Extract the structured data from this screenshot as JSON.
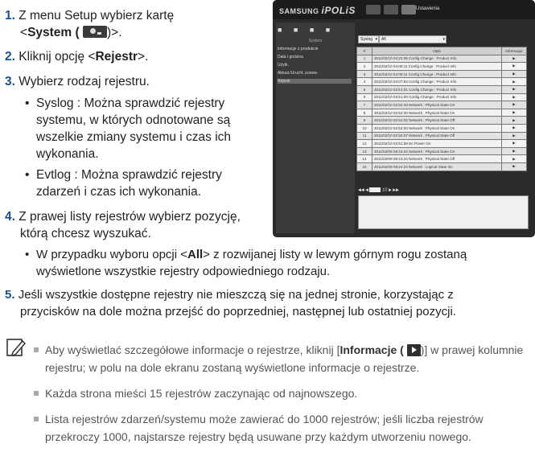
{
  "steps": {
    "s1": {
      "num": "1.",
      "a": "Z menu Setup wybierz kartę",
      "b": "<",
      "bold": "System (",
      "c": ")>."
    },
    "s2": {
      "num": "2.",
      "a": "Kliknij opcję <",
      "bold": "Rejestr",
      "c": ">."
    },
    "s3": {
      "num": "3.",
      "a": "Wybierz rodzaj rejestru."
    },
    "b1": [
      "Syslog : Można sprawdzić rejestry",
      "systemu, w których odnotowane są",
      "wszelkie zmiany systemu i czas ich",
      "wykonania."
    ],
    "b2": [
      "Evtlog : Można sprawdzić rejestry",
      "zdarzeń i czas ich wykonania."
    ],
    "s4": {
      "num": "4.",
      "line1": "Z prawej listy rejestrów wybierz pozycję,",
      "line2": "którą chcesz wyszukać."
    },
    "b3": {
      "a": "W przypadku wyboru opcji <",
      "bold": "All",
      "c": "> z rozwijanej listy w lewym górnym rogu zostaną",
      "line2": "wyświetlone wszystkie rejestry odpowiedniego rodzaju."
    },
    "s5": {
      "num": "5.",
      "line1": "Jeśli wszystkie dostępne rejestry nie mieszczą się na jednej stronie, korzystając z",
      "line2": "przycisków na dole można przejść do poprzedniej, następnej lub ostatniej pozycji."
    }
  },
  "notes": {
    "n1": {
      "a": "Aby wyświetlać szczegółowe informacje o rejestrze, kliknij [",
      "bold": "Informacje (",
      "c": ")] w prawej kolumnie",
      "line2": "rejestru; w polu na dole ekranu zostaną wyświetlone informacje o rejestrze."
    },
    "n2": "Każda strona mieści 15 rejestrów zaczynając od najnowszego.",
    "n3": [
      "Lista rejestrów zdarzeń/systemu może zawierać do 1000 rejestrów; jeśli liczba rejestrów",
      "przekroczy 1000, najstarsze rejestry będą usuwane przy każdym utworzeniu nowego."
    ]
  },
  "screenshot": {
    "logo_a": "SAMSUNG ",
    "logo_b": "iPOLiS",
    "title": "Ustawienia",
    "side_header": "System",
    "side_items": [
      "Informacje o produkcie",
      "Data i godzina",
      "Użytk.",
      "Aktual./Urucht. ponow.",
      "Rejestr"
    ],
    "filter1": "Syslog",
    "filter2": "All",
    "columns": [
      "#",
      "Opis",
      "Informacje"
    ],
    "rows": [
      {
        "n": "1",
        "d": "2011/02/10 04:22:09 Config Change : Product Info"
      },
      {
        "n": "2",
        "d": "2011/02/10 04:09:11 Config Change : Product Info"
      },
      {
        "n": "3",
        "d": "2011/02/10 04:09:11 Config Change : Product Info"
      },
      {
        "n": "4",
        "d": "2011/02/10 04:07:53 Config Change : Product Info"
      },
      {
        "n": "5",
        "d": "2011/02/10 03:51:01 Config Change : Product Info"
      },
      {
        "n": "6",
        "d": "2011/02/10 03:51:00 Config Change : Product Info"
      },
      {
        "n": "7",
        "d": "2011/02/10 02:52:33 Network : Physical State On"
      },
      {
        "n": "8",
        "d": "2011/02/10 02:52:00 Network : Physical State On"
      },
      {
        "n": "9",
        "d": "2011/02/10 02:52:02 Network : Physical State Off"
      },
      {
        "n": "10",
        "d": "2011/02/10 02:52:00 Network : Physical State On"
      },
      {
        "n": "11",
        "d": "2011/02/10 02:52:07 Network : Physical State Off"
      },
      {
        "n": "12",
        "d": "2011/02/10 02:51:59 Dc Power On"
      },
      {
        "n": "13",
        "d": "2011/02/09 09:24:24 Network : Physical State On"
      },
      {
        "n": "14",
        "d": "2011/02/09 09:24:24 Network : Physical State Off"
      },
      {
        "n": "15",
        "d": "2011/02/09 09:24:24 Network : Logical State On"
      }
    ],
    "pager": "1/2"
  }
}
